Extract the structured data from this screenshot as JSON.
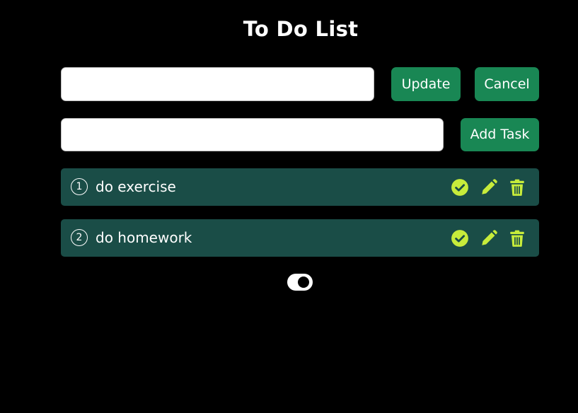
{
  "app": {
    "title": "To Do List"
  },
  "update_form": {
    "input_value": "",
    "update_label": "Update",
    "cancel_label": "Cancel"
  },
  "add_form": {
    "input_value": "",
    "add_label": "Add Task"
  },
  "tasks": [
    {
      "number": "1",
      "text": "do exercise",
      "icons": [
        "circle-check-icon",
        "pencil-icon",
        "trash-icon"
      ]
    },
    {
      "number": "2",
      "text": "do homework",
      "icons": [
        "circle-check-icon",
        "pencil-icon",
        "trash-icon"
      ]
    }
  ],
  "theme_toggle": {
    "state": "on"
  },
  "colors": {
    "background": "#000000",
    "button": "#198754",
    "task_row": "#1a4d47",
    "icon": "#c7ec3b",
    "text": "#ffffff"
  }
}
